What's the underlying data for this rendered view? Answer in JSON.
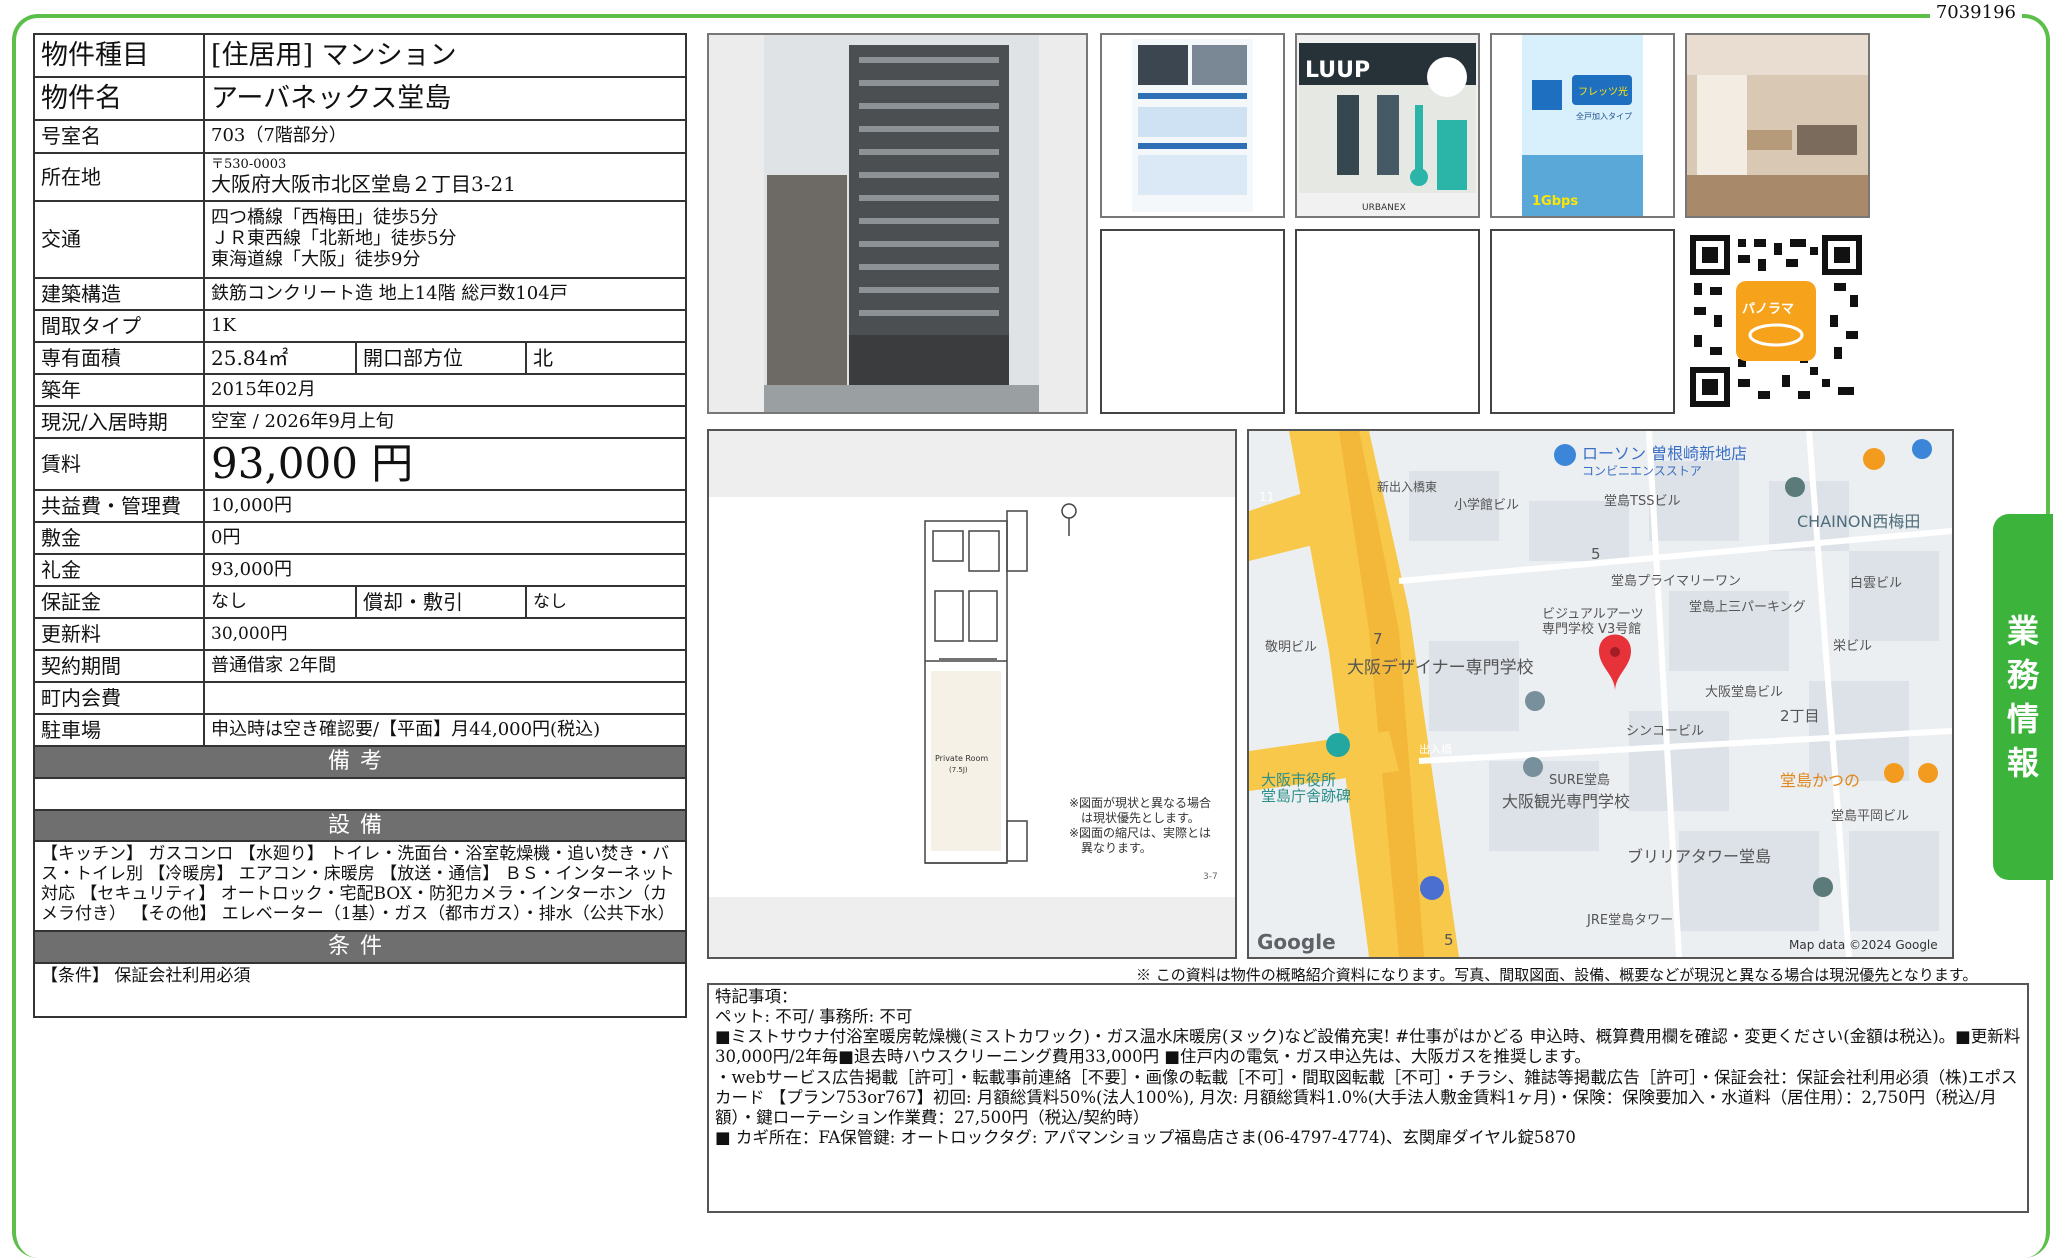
{
  "doc_id": "7039196",
  "side_tab": [
    "業",
    "務",
    "情",
    "報"
  ],
  "property": {
    "type_label": "物件種目",
    "type_value": "[住居用] マンション",
    "name_label": "物件名",
    "name_value": "アーバネックス堂島",
    "room_label": "号室名",
    "room_value": "703（7階部分）",
    "address_label": "所在地",
    "postal": "〒530-0003",
    "address": "大阪府大阪市北区堂島２丁目3-21",
    "transport_label": "交通",
    "transport": [
      "四つ橋線「西梅田」徒歩5分",
      "ＪＲ東西線「北新地」徒歩5分",
      "東海道線「大阪」徒歩9分"
    ],
    "structure_label": "建築構造",
    "structure_value": "鉄筋コンクリート造 地上14階 総戸数104戸",
    "layout_label": "間取タイプ",
    "layout_value": "1K",
    "area_label": "専有面積",
    "area_value": "25.84㎡",
    "opening_label": "開口部方位",
    "opening_value": "北",
    "built_label": "築年",
    "built_value": "2015年02月",
    "status_label": "現況/入居時期",
    "status_value": "空室 / 2026年9月上旬",
    "rent_label": "賃料",
    "rent_value": "93,000 円",
    "fee_label": "共益費・管理費",
    "fee_value": "10,000円",
    "deposit_label": "敷金",
    "deposit_value": "0円",
    "key_money_label": "礼金",
    "key_money_value": "93,000円",
    "guarantee_label": "保証金",
    "guarantee_value": "なし",
    "amort_label": "償却・敷引",
    "amort_value": "なし",
    "renewal_label": "更新料",
    "renewal_value": "30,000円",
    "contract_label": "契約期間",
    "contract_value": "普通借家 2年間",
    "community_label": "町内会費",
    "community_value": "",
    "parking_label": "駐車場",
    "parking_value": "申込時は空き確認要/【平面】月44,000円(税込)"
  },
  "sections": {
    "remarks_header": "備考",
    "facilities_header": "設備",
    "facilities_text": "【キッチン】 ガスコンロ 【水廻り】 トイレ・洗面台・浴室乾燥機・追い焚き・バス・トイレ別 【冷暖房】 エアコン・床暖房 【放送・通信】 ＢＳ・インターネット対応 【セキュリティ】 オートロック・宅配BOX・防犯カメラ・インターホン（カメラ付き） 【その他】 エレベーター（1基）・ガス（都市ガス）・排水（公共下水）",
    "conditions_header": "条件",
    "conditions_text": "【条件】 保証会社利用必須"
  },
  "thumbs": {
    "luup_text": "LUUP",
    "urbanex_text": "URBANEX",
    "flets_text": "フレッツ光",
    "flets_sub": "全戸加入タイプ",
    "gbps_text": "1Gbps",
    "qr_text": "パノラマ"
  },
  "floorplan": {
    "room_label": "Private Room",
    "room_size": "(7.5J)",
    "note": [
      "※図面が現状と異なる場合",
      "は現状優先とします。",
      "※図面の縮尺は、実際とは",
      "異なります。"
    ],
    "page": "3-7"
  },
  "map": {
    "labels": [
      "ローソン 曽根崎新地店",
      "コンビニエンスストア",
      "新出入橋東",
      "小学館ビル",
      "堂島TSSビル",
      "CHAINON西梅田",
      "白雲ビル",
      "堂島プライマリーワン",
      "堂島上三パーキング",
      "ビジュアルアーツ",
      "専門学校 V3号館",
      "栄ビル",
      "敬明ビル",
      "大阪デザイナー専門学校",
      "大阪堂島ビル",
      "2丁目",
      "シンコービル",
      "大阪市役所",
      "堂島庁舎跡碑",
      "SURE堂島",
      "大阪観光専門学校",
      "堂島かつの",
      "堂島平岡ビル",
      "ブリリアタワー堂島",
      "JRE堂島タワー",
      "出入橋"
    ],
    "num_labels": [
      "11",
      "5",
      "7",
      "5"
    ],
    "google": "Google",
    "credit": "Map data ©2024 Google"
  },
  "disclaimer": "※ この資料は物件の概略紹介資料になります。写真、間取図面、設備、概要などが現況と異なる場合は現況優先となります。",
  "remarks": {
    "lines": [
      "特記事項：",
      "ペット: 不可/ 事務所: 不可",
      "■ミストサウナ付浴室暖房乾燥機(ミストカワック)・ガス温水床暖房(ヌック)など設備充実! #仕事がはかどる 申込時、概算費用欄を確認・変更ください(金額は税込)。■更新料30,000円/2年毎■退去時ハウスクリーニング費用33,000円 ■住戸内の電気・ガス申込先は、大阪ガスを推奨します。",
      "・webサービス広告掲載［許可］・転載事前連絡［不要］・画像の転載［不可］・間取図転載［不可］・チラシ、雑誌等掲載広告［許可］・保証会社：保証会社利用必須（株)エポスカード 【プラン753or767】初回: 月額総賃料50%(法人100%), 月次: 月額総賃料1.0%(大手法人敷金賃料1ヶ月)・保険：保険要加入・水道料（居住用）：2,750円（税込/月額）・鍵ローテーション作業費：27,500円（税込/契約時）",
      "■ カギ所在：FA保管鍵: オートロックタグ: アパマンショップ福島店さま(06-4797-4774)、玄関扉ダイヤル錠5870"
    ]
  }
}
